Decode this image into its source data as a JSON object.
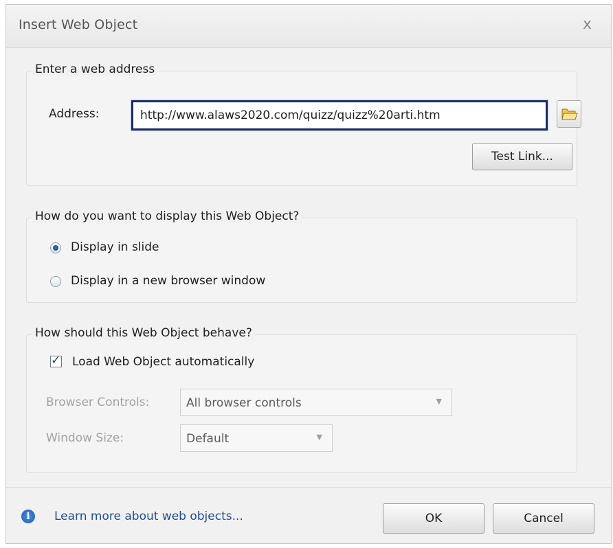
{
  "dialog": {
    "title": "Insert Web Object",
    "close_glyph": "x"
  },
  "address_group": {
    "legend": "Enter a web address",
    "address_label": "Address:",
    "address_value": "http://www.alaws2020.com/quizz/quizz%20arti.htm",
    "browse_icon": "folder-icon",
    "test_link_label": "Test Link..."
  },
  "display_group": {
    "legend": "How do you want to display this Web Object?",
    "options": [
      {
        "label": "Display in slide",
        "selected": true
      },
      {
        "label": "Display in a new browser window",
        "selected": false
      }
    ]
  },
  "behave_group": {
    "legend": "How should this Web Object behave?",
    "load_auto_label": "Load Web Object automatically",
    "load_auto_checked": true,
    "browser_controls_label": "Browser Controls:",
    "browser_controls_value": "All browser controls",
    "window_size_label": "Window Size:",
    "window_size_value": "Default"
  },
  "footer": {
    "info_icon": "info-icon",
    "learn_more_label": "Learn more about web objects...",
    "ok_label": "OK",
    "cancel_label": "Cancel"
  },
  "colors": {
    "address_border": "#1c2b64",
    "link": "#1f4d99",
    "dialog_bg": "#f1f1f1"
  }
}
